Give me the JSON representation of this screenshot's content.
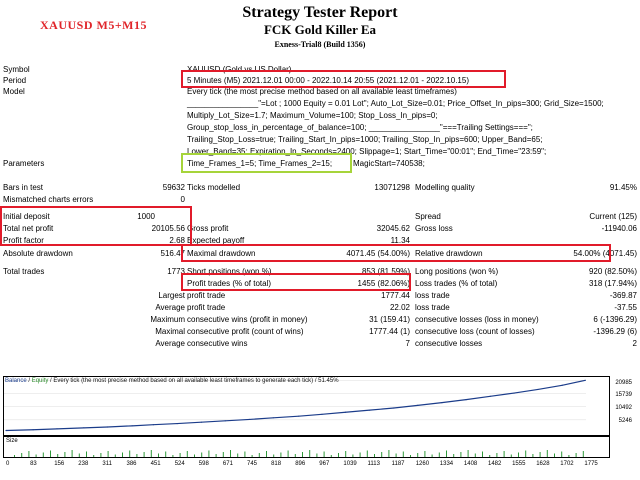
{
  "header": {
    "tag": "XAUUSD M5+M15",
    "title": "Strategy Tester Report",
    "ea": "FCK Gold Killer Ea",
    "account": "Exness-Trial8 (Build 1356)"
  },
  "settings": {
    "symbol_label": "Symbol",
    "symbol_value": "XAUUSD (Gold vs US Dollar)",
    "period_label": "Period",
    "period_value": "5 Minutes (M5) 2021.12.01 00:00 - 2022.10.14 20:55 (2021.12.01 - 2022.10.15)",
    "model_label": "Model",
    "model_value": "Every tick (the most precise method based on all available least timeframes)",
    "param_lines": [
      "________________\"=Lot ; 1000 Equity = 0.01 Lot\"; Auto_Lot_Size=0.01; Price_Offset_In_pips=300; Grid_Size=1500;",
      "Multiply_Lot_Size=1.7; Maximum_Volume=100; Stop_Loss_In_pips=0;",
      "Group_stop_loss_in_percentage_of_balance=100; ________________\"===Trailing Settings===\";",
      "Trailing_Stop_Loss=true; Trailing_Start_In_pips=1000; Trailing_Stop_In_pips=600; Upper_Band=65;",
      "Lower_Band=35; Expiration_In_Seconds=2400; Slippage=1; Start_Time=\"00:01\"; End_Time=\"23:59\";"
    ],
    "parameters_label": "Parameters",
    "parameters_value": "Time_Frames_1=5; Time_Frames_2=15;",
    "parameters_tail": "MagicStart=740538;"
  },
  "stats": {
    "bars_label": "Bars in test",
    "bars_value": "59632",
    "ticks_label": "Ticks modelled",
    "ticks_value": "13071298",
    "quality_label": "Modelling quality",
    "quality_value": "91.45%",
    "mismatch_label": "Mismatched charts errors",
    "mismatch_value": "0",
    "deposit_label": "Initial deposit",
    "deposit_value": "1000",
    "spread_label": "Spread",
    "spread_value": "Current (125)",
    "netprofit_label": "Total net profit",
    "netprofit_value": "20105.56",
    "grossprofit_label": "Gross profit",
    "grossprofit_value": "32045.62",
    "grossloss_label": "Gross loss",
    "grossloss_value": "-11940.06",
    "pf_label": "Profit factor",
    "pf_value": "2.68",
    "payoff_label": "Expected payoff",
    "payoff_value": "11.34",
    "absdd_label": "Absolute drawdown",
    "absdd_value": "516.47",
    "maxdd_label": "Maximal drawdown",
    "maxdd_value": "4071.45 (54.00%)",
    "reldd_label": "Relative drawdown",
    "reldd_value": "54.00% (4071.45)",
    "trades_label": "Total trades",
    "trades_value": "1773",
    "short_label": "Short positions (won %)",
    "short_value": "853 (81.59%)",
    "long_label": "Long positions (won %)",
    "long_value": "920 (82.50%)",
    "pt_label": "Profit trades (% of total)",
    "pt_value": "1455 (82.06%)",
    "lt_label": "Loss trades (% of total)",
    "lt_value": "318 (17.94%)",
    "largest_label": "Largest",
    "largest_profit_label": "profit trade",
    "largest_profit_value": "1777.44",
    "largest_loss_label": "loss trade",
    "largest_loss_value": "-369.87",
    "average_label": "Average",
    "average_profit_label": "profit trade",
    "average_profit_value": "22.02",
    "average_loss_label": "loss trade",
    "average_loss_value": "-37.55",
    "maximum_label": "Maximum",
    "max_wins_label": "consecutive wins (profit in money)",
    "max_wins_value": "31 (159.41)",
    "max_losses_label": "consecutive losses (loss in money)",
    "max_losses_value": "6 (-1396.29)",
    "maximal_label": "Maximal",
    "maximal_profit_label": "consecutive profit (count of wins)",
    "maximal_profit_value": "1777.44 (1)",
    "maximal_loss_label": "consecutive loss (count of losses)",
    "maximal_loss_value": "-1396.29 (6)",
    "avg_label": "Average",
    "avg_wins_label": "consecutive wins",
    "avg_wins_value": "7",
    "avg_losses_label": "consecutive losses",
    "avg_losses_value": "2"
  },
  "chart": {
    "legend_balance": "Balance",
    "legend_sep": " / ",
    "legend_equity": "Equity",
    "legend_rest": " / Every tick (the most precise method based on all available least timeframes to generate each tick) / 51.45%",
    "size_label": "Size",
    "y_ticks": [
      "20985",
      "15739",
      "10492",
      "5246"
    ],
    "x_ticks": [
      "0",
      "83",
      "156",
      "238",
      "311",
      "386",
      "451",
      "524",
      "598",
      "671",
      "745",
      "818",
      "896",
      "967",
      "1039",
      "1113",
      "1187",
      "1260",
      "1334",
      "1408",
      "1482",
      "1555",
      "1628",
      "1702",
      "1775"
    ]
  },
  "chart_data": {
    "type": "line",
    "series": [
      {
        "name": "Balance",
        "color": "#1b3c8a",
        "x": [
          0,
          83,
          156,
          238,
          311,
          386,
          451,
          524,
          598,
          671,
          745,
          818,
          896,
          967,
          1039,
          1113,
          1187,
          1260,
          1334,
          1408,
          1482,
          1555,
          1628,
          1702,
          1773
        ],
        "values": [
          1000,
          1300,
          1650,
          2050,
          2400,
          2850,
          3300,
          3750,
          4300,
          4850,
          5400,
          6050,
          6700,
          7450,
          8250,
          9100,
          9950,
          11000,
          12100,
          13300,
          14600,
          15900,
          17350,
          19000,
          20985
        ]
      }
    ],
    "y_ticks": [
      5246,
      10492,
      15739,
      20985
    ],
    "xlim": [
      0,
      1775
    ],
    "ylim": [
      0,
      21500
    ]
  }
}
